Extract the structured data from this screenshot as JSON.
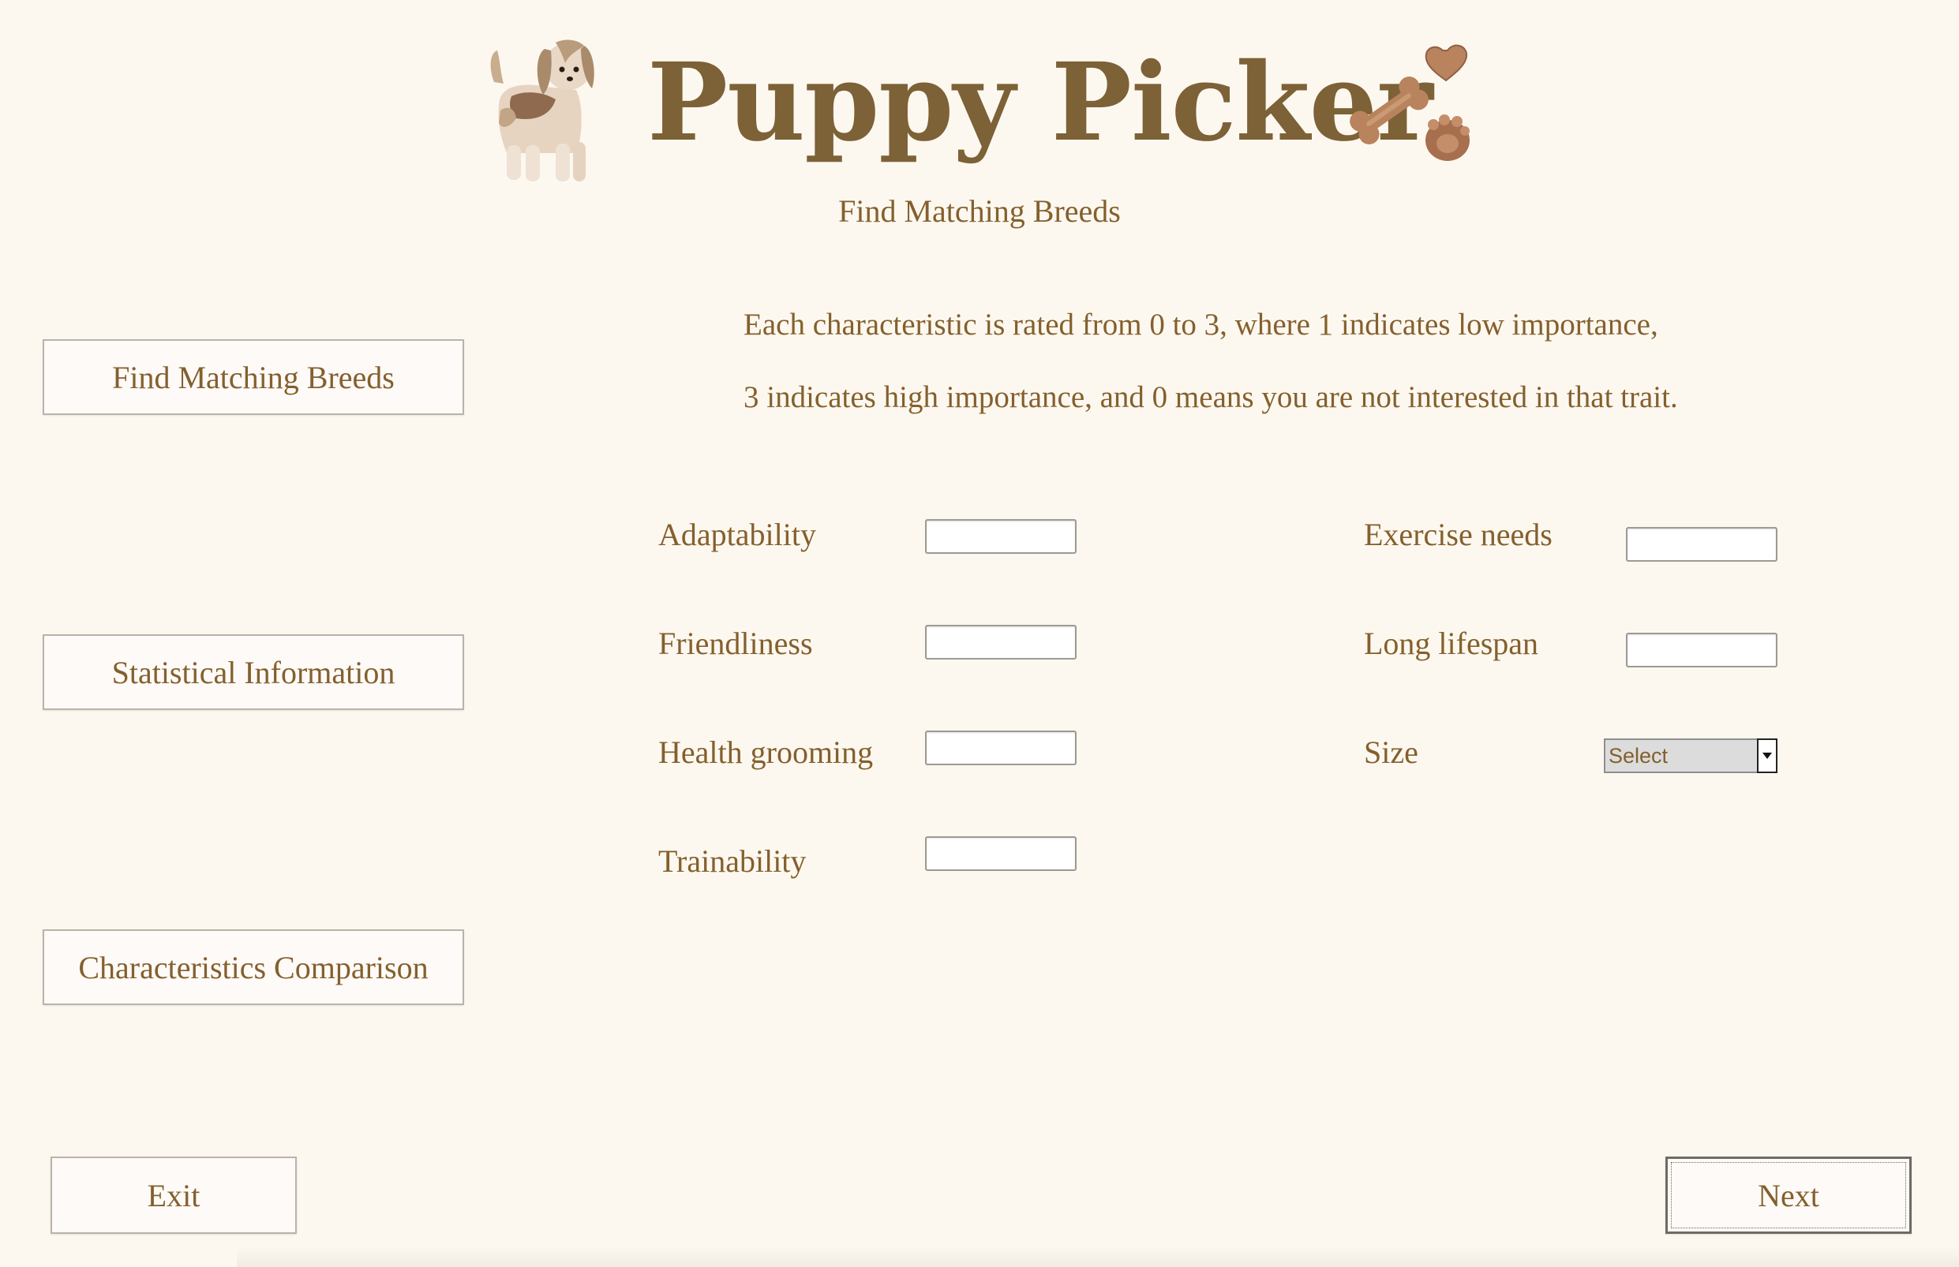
{
  "header": {
    "title": "Puppy Picker",
    "subtitle": "Find Matching Breeds",
    "logo_icon": "dog-icon",
    "decoration_icon": "bone-heart-paw-icon"
  },
  "sidebar": {
    "items": [
      {
        "label": "Find Matching Breeds"
      },
      {
        "label": "Statistical Information"
      },
      {
        "label": "Characteristics Comparison"
      }
    ]
  },
  "instructions": {
    "line1": "Each characteristic is rated from 0 to 3, where 1 indicates low importance,",
    "line2": "3 indicates high importance, and 0 means you are not interested in that trait."
  },
  "form": {
    "left_fields": [
      {
        "label": "Adaptability",
        "value": ""
      },
      {
        "label": "Friendliness",
        "value": ""
      },
      {
        "label": "Health grooming",
        "value": ""
      },
      {
        "label": "Trainability",
        "value": ""
      }
    ],
    "right_fields": [
      {
        "label": "Exercise needs",
        "value": ""
      },
      {
        "label": "Long lifespan",
        "value": ""
      }
    ],
    "size": {
      "label": "Size",
      "selected": "Select"
    }
  },
  "footer": {
    "exit_label": "Exit",
    "next_label": "Next"
  },
  "colors": {
    "background": "#fdf8ef",
    "text": "#84602e",
    "title": "#7d6137"
  }
}
